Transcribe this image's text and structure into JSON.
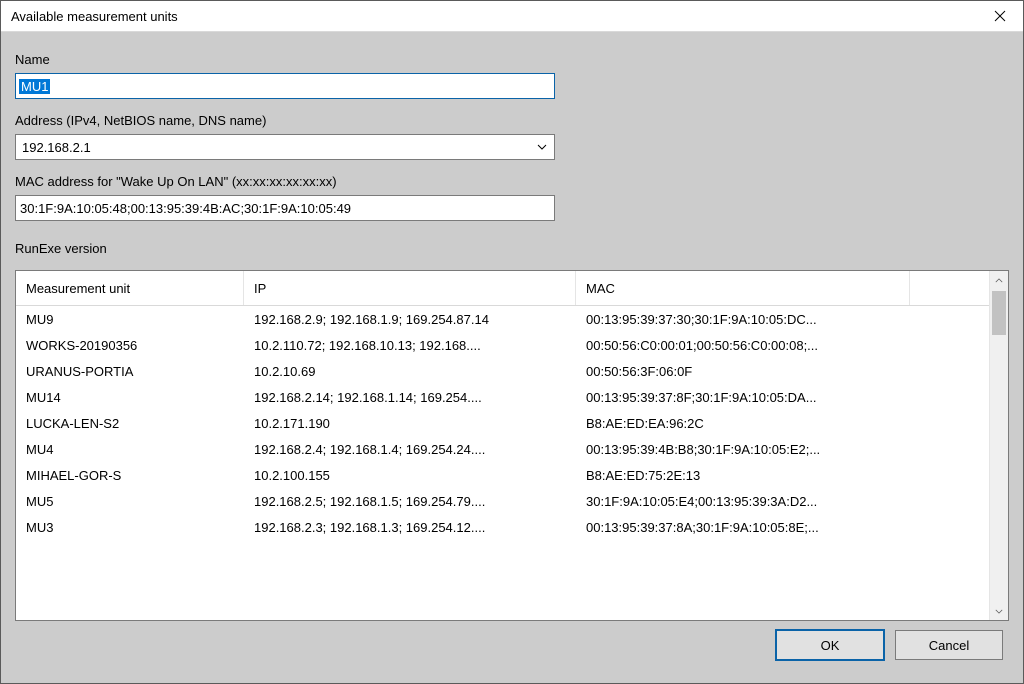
{
  "window": {
    "title": "Available measurement units"
  },
  "labels": {
    "name": "Name",
    "address": "Address (IPv4, NetBIOS name, DNS name)",
    "mac": "MAC address for \"Wake Up On LAN\" (xx:xx:xx:xx:xx:xx)",
    "runexe": "RunExe version"
  },
  "fields": {
    "name_value": "MU1",
    "address_value": "192.168.2.1",
    "mac_value": "30:1F:9A:10:05:48;00:13:95:39:4B:AC;30:1F:9A:10:05:49"
  },
  "columns": {
    "mu": "Measurement unit",
    "ip": "IP",
    "mac": "MAC"
  },
  "rows": [
    {
      "mu": "MU9",
      "ip": "192.168.2.9; 192.168.1.9; 169.254.87.14",
      "mac": "00:13:95:39:37:30;30:1F:9A:10:05:DC..."
    },
    {
      "mu": "WORKS-20190356",
      "ip": "10.2.110.72; 192.168.10.13; 192.168....",
      "mac": "00:50:56:C0:00:01;00:50:56:C0:00:08;..."
    },
    {
      "mu": "URANUS-PORTIA",
      "ip": "10.2.10.69",
      "mac": "00:50:56:3F:06:0F"
    },
    {
      "mu": "MU14",
      "ip": "192.168.2.14; 192.168.1.14; 169.254....",
      "mac": "00:13:95:39:37:8F;30:1F:9A:10:05:DA..."
    },
    {
      "mu": "LUCKA-LEN-S2",
      "ip": "10.2.171.190",
      "mac": "B8:AE:ED:EA:96:2C"
    },
    {
      "mu": "MU4",
      "ip": "192.168.2.4; 192.168.1.4; 169.254.24....",
      "mac": "00:13:95:39:4B:B8;30:1F:9A:10:05:E2;..."
    },
    {
      "mu": "MIHAEL-GOR-S",
      "ip": "10.2.100.155",
      "mac": "B8:AE:ED:75:2E:13"
    },
    {
      "mu": "MU5",
      "ip": "192.168.2.5; 192.168.1.5; 169.254.79....",
      "mac": "30:1F:9A:10:05:E4;00:13:95:39:3A:D2..."
    },
    {
      "mu": "MU3",
      "ip": "192.168.2.3; 192.168.1.3; 169.254.12....",
      "mac": "00:13:95:39:37:8A;30:1F:9A:10:05:8E;..."
    }
  ],
  "buttons": {
    "ok": "OK",
    "cancel": "Cancel"
  }
}
